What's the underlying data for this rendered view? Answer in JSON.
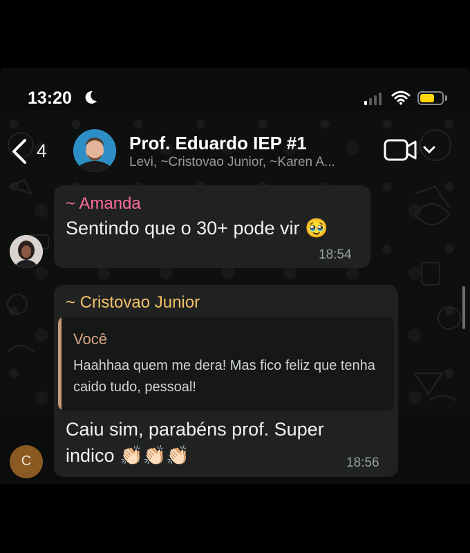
{
  "status_bar": {
    "time": "13:20"
  },
  "header": {
    "back_count": "4",
    "title": "Prof. Eduardo IEP #1",
    "subtitle": "Levi, ~Cristovao Junior, ~Karen A..."
  },
  "messages": [
    {
      "sender": "~ Amanda",
      "sender_color": "#ff6b9a",
      "text": "Sentindo que o 30+ pode vir 🥹",
      "time": "18:54"
    },
    {
      "sender": "~ Cristovao Junior",
      "sender_color": "#f2c266",
      "avatar_initial": "C",
      "quote": {
        "author": "Você",
        "text": "Haahhaa quem me dera! Mas fico feliz que tenha caido tudo, pessoal!"
      },
      "text_line1": "Caiu sim, parabéns prof. Super",
      "text_line2": "indico 👏🏻👏🏻👏🏻",
      "time": "18:56"
    }
  ],
  "icons": {
    "moon": "moon-icon",
    "signal": "signal-icon",
    "wifi": "wifi-icon",
    "battery": "battery-icon",
    "back": "chevron-left-icon",
    "video": "video-camera-icon",
    "chevron": "chevron-down-icon"
  },
  "colors": {
    "battery": "#ffd60a",
    "amanda": "#ff6b9a",
    "cristovao": "#f2c266",
    "quote_bar": "#c9997a"
  }
}
